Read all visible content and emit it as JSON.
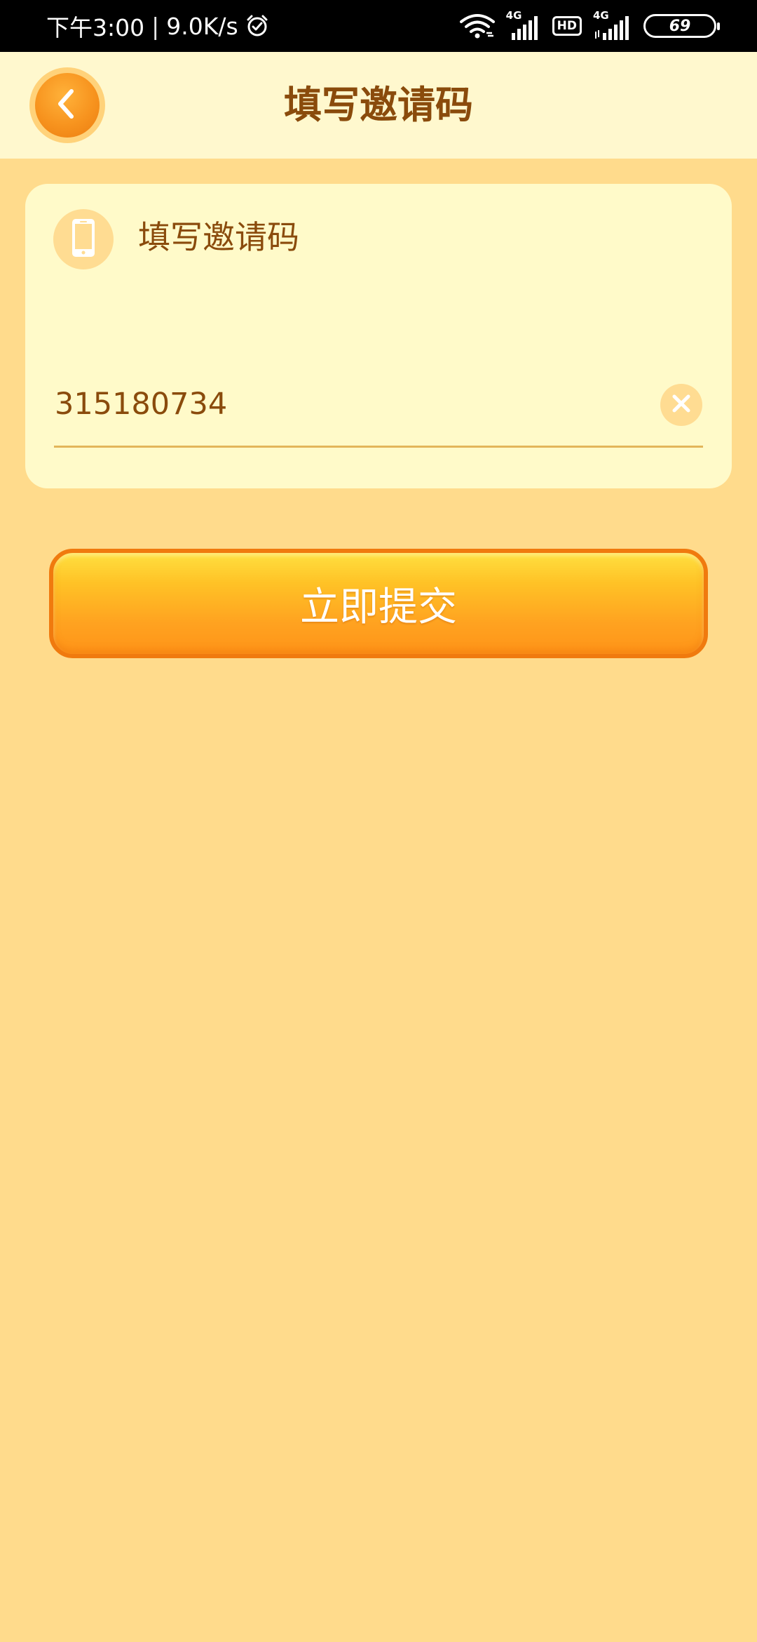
{
  "status_bar": {
    "time": "下午3:00",
    "separator": "|",
    "speed": "9.0K/s",
    "sim1_tag": "4G",
    "hd": "HD",
    "sim2_tag": "4G",
    "battery": "69",
    "icons": [
      "alarm-icon",
      "wifi-icon",
      "signal-icon",
      "hd-icon",
      "signal-icon",
      "battery-icon"
    ]
  },
  "header": {
    "title": "填写邀请码",
    "back_icon": "chevron-left-icon"
  },
  "form": {
    "label": "填写邀请码",
    "label_icon": "phone-icon",
    "invite_code_value": "315180734",
    "clear_icon": "close-icon"
  },
  "submit": {
    "label": "立即提交"
  },
  "colors": {
    "background": "#FFDB8C",
    "header_background": "#FFF8CE",
    "card_background": "#FFFAC9",
    "text_brown": "#8A4B0C",
    "accent_orange": "#F7931E",
    "button_border": "#F07A0E"
  }
}
